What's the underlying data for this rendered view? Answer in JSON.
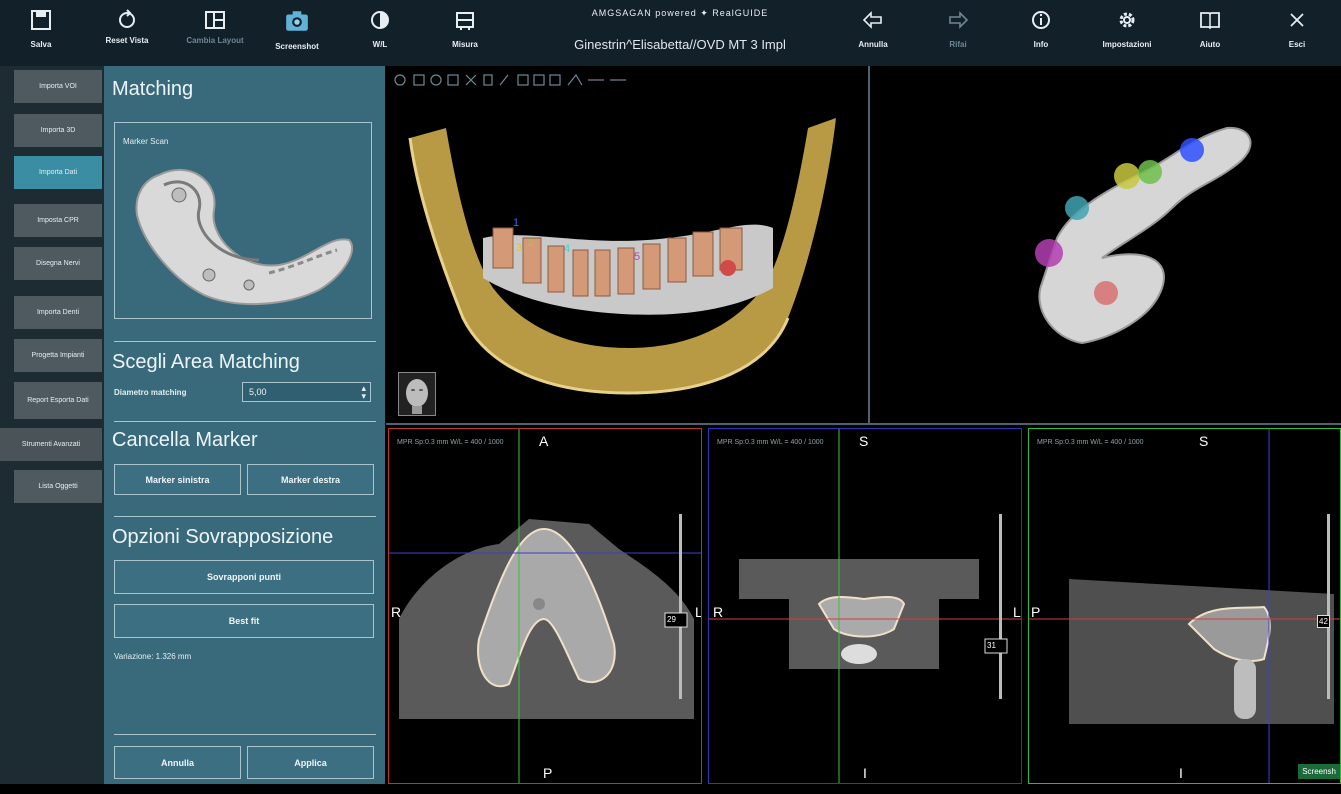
{
  "toolbar": {
    "save": "Salva",
    "reset_view": "Reset Vista",
    "change_layout": "Cambia Layout",
    "screenshot": "Screenshot",
    "wl": "W/L",
    "measure": "Misura",
    "undo": "Annulla",
    "redo": "Rifai",
    "info": "Info",
    "settings": "Impostazioni",
    "help": "Aiuto",
    "exit": "Esci"
  },
  "brand": {
    "logos": "AMGSAGAN powered ✦ RealGUIDE",
    "patient": "Ginestrin^Elisabetta//OVD MT 3 Impl"
  },
  "sidebar": {
    "items": [
      {
        "label": "Importa VOI"
      },
      {
        "label": "Importa 3D"
      },
      {
        "label": "Importa Dati"
      },
      {
        "label": "Imposta CPR"
      },
      {
        "label": "Disegna Nervi"
      },
      {
        "label": "Importa Denti"
      },
      {
        "label": "Progetta Impianti"
      },
      {
        "label": "Report Esporta Dati"
      },
      {
        "label": "Strumenti Avanzati"
      },
      {
        "label": "Lista Oggetti"
      }
    ]
  },
  "panel": {
    "title": "Matching",
    "marker_scan_label": "Marker Scan",
    "area_title": "Scegli Area Matching",
    "diameter_label": "Diametro matching",
    "diameter_value": "5,00",
    "delete_title": "Cancella Marker",
    "marker_left": "Marker sinistra",
    "marker_right": "Marker destra",
    "overlay_title": "Opzioni Sovrapposizione",
    "overlay_points": "Sovrapponi punti",
    "best_fit": "Best fit",
    "variation": "Variazione: 1.326 mm",
    "cancel": "Annulla",
    "apply": "Applica"
  },
  "views": {
    "axial": {
      "info": "MPR  Sp:0.3 mm  W/L = 400 / 1000",
      "top": "A",
      "bottom": "P",
      "left": "R",
      "right": "L",
      "slice": "29"
    },
    "coronal": {
      "info": "MPR  Sp:0.3 mm  W/L = 400 / 1000",
      "top": "S",
      "bottom": "I",
      "left": "R",
      "right": "L",
      "slice": "31"
    },
    "sagittal": {
      "info": "MPR  Sp:0.3 mm  W/L = 400 / 1000",
      "top": "S",
      "bottom": "I",
      "left": "P",
      "slice": "42"
    },
    "screenshot_badge": "Screensh",
    "markers": [
      "1",
      "2",
      "3",
      "4",
      "5"
    ]
  },
  "colors": {
    "panel": "#386a7c",
    "accent": "#3a8da3",
    "toolbar": "#12202a"
  }
}
